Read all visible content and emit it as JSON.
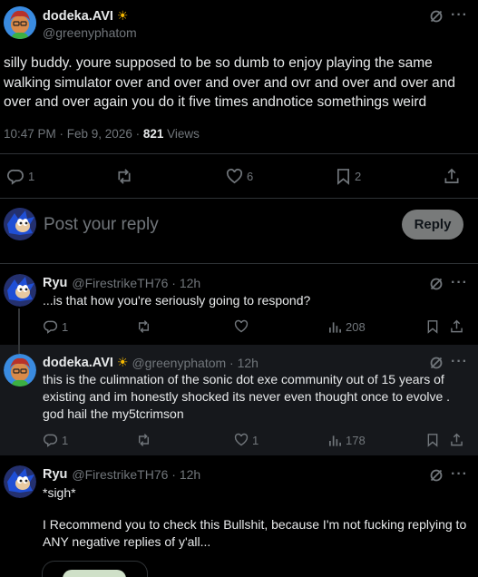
{
  "main_post": {
    "display_name": "dodeka.AVI",
    "badge": "sun-emoji",
    "handle": "@greenyphatom",
    "text": "silly buddy. youre supposed to be so dumb to enjoy playing the same walking simulator over and over and over and ovr and over and over and over and over again you do it five times andnotice somethings weird",
    "timestamp": "10:47 PM · Feb 9, 2026 · ",
    "views_count": "821",
    "views_label": " Views",
    "actions": {
      "replies": "1",
      "reposts": "",
      "likes": "6",
      "bookmarks": "2"
    }
  },
  "reply_box": {
    "placeholder": "Post your reply",
    "button_label": "Reply"
  },
  "replies": [
    {
      "display_name": "Ryu",
      "handle": "@FirestrikeTH76 · 12h",
      "text": "...is that how you're seriously going to respond?",
      "actions": {
        "replies": "1",
        "reposts": "",
        "likes": "",
        "views": "208"
      }
    },
    {
      "display_name": "dodeka.AVI",
      "badge": "sun-emoji",
      "handle": "@greenyphatom · 12h",
      "text": "this is the culimnation of the sonic dot exe community out of 15 years of existing and im honestly shocked its never even thought once to evolve . god hail the my5tcrimson",
      "actions": {
        "replies": "1",
        "reposts": "",
        "likes": "1",
        "views": "178"
      }
    },
    {
      "display_name": "Ryu",
      "handle": "@FirestrikeTH76 · 12h",
      "text_line1": "*sigh*",
      "text_line2": "I Recommend you to check this Bullshit, because I'm not fucking replying to ANY negative replies of y'all..."
    }
  ],
  "colors": {
    "background": "#000000",
    "text": "#e7e9ea",
    "muted": "#71767b",
    "divider": "#2f3336",
    "reply_button_bg": "#787a7a",
    "highlight_bg": "#16181c"
  }
}
